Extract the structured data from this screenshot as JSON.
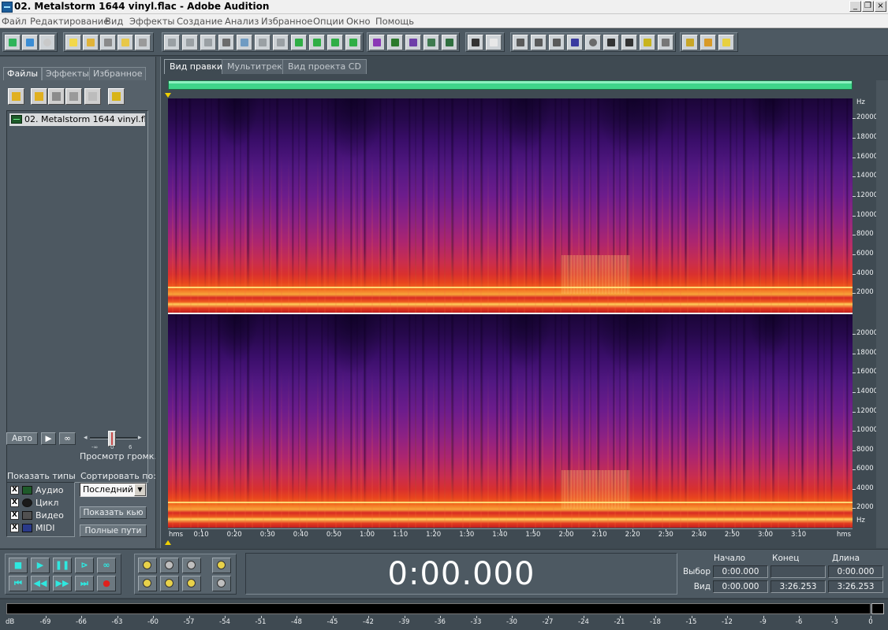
{
  "window": {
    "title": "02. Metalstorm 1644 vinyl.flac - Adobe Audition",
    "controls": [
      "_",
      "❐",
      "×"
    ]
  },
  "menu": [
    "Файл",
    "Редактирование",
    "Вид",
    "Эффекты",
    "Создание",
    "Анализ",
    "Избранное",
    "Опции",
    "Окно",
    "Помощь"
  ],
  "toolbar": {
    "tools": [
      "waveform-view-icon",
      "multitrack-view-icon",
      "cd-view-icon",
      "new-icon",
      "open-icon",
      "save-icon",
      "save-all-icon",
      "close-file-icon",
      "undo-icon",
      "redo-icon",
      "repeat-icon",
      "copy-icon",
      "paste-icon",
      "cut-icon",
      "trim-icon",
      "mix-paste-icon",
      "insert-icon",
      "extract-icon",
      "loop-icon",
      "spectral-view-icon",
      "waveform-icon",
      "spectral-pan-icon",
      "spectral-phase-icon",
      "spectral-freq-icon",
      "time-selection-icon",
      "marquee-icon",
      "window-1-icon",
      "window-2-icon",
      "window-3-icon",
      "play-marker-icon",
      "zoom-icon",
      "time-format-icon",
      "ruler-icon",
      "level-icon",
      "bar-icon",
      "settings-icon",
      "gear-icon",
      "help-icon"
    ],
    "accent": "#cdd2d6"
  },
  "left_panel": {
    "tabs": [
      "Файлы",
      "Эффекты",
      "Избранное"
    ],
    "active_tab": "Файлы",
    "file_actions": [
      "import-icon",
      "open-folder-icon",
      "properties-icon",
      "close-icon",
      "insert-icon",
      "sort-icon"
    ],
    "files": [
      "02. Metalstorm 1644 vinyl.flac"
    ],
    "auto_button": "Авто",
    "volume": {
      "label": "Просмотр громк.",
      "ticks": [
        "-∞",
        "0",
        "6"
      ],
      "level_db": 0
    },
    "show_types_label": "Показать типы",
    "types": [
      {
        "label": "Аудио",
        "checked": "X",
        "icon": "audio-type-icon"
      },
      {
        "label": "Цикл",
        "checked": "X",
        "icon": "loop-type-icon"
      },
      {
        "label": "Видео",
        "checked": "X",
        "icon": "video-type-icon"
      },
      {
        "label": "MIDI",
        "checked": "X",
        "icon": "midi-type-icon"
      }
    ],
    "sort_label": "Сортировать по:",
    "sort_value": "Последний д",
    "show_cues_button": "Показать кью",
    "full_paths_button": "Полные пути"
  },
  "view_tabs": [
    "Вид правки",
    "Мультитрек",
    "Вид проекта CD"
  ],
  "active_view": "Вид правки",
  "spectrogram": {
    "freq_unit": "Hz",
    "freq_labels": [
      "20000",
      "18000",
      "16000",
      "14000",
      "12000",
      "10000",
      "8000",
      "6000",
      "4000",
      "2000"
    ],
    "freq_values": [
      20000,
      18000,
      16000,
      14000,
      12000,
      10000,
      8000,
      6000,
      4000,
      2000
    ],
    "freq_max": 22050,
    "time_unit": "hms",
    "time_labels": [
      "0:10",
      "0:20",
      "0:30",
      "0:40",
      "0:50",
      "1:00",
      "1:10",
      "1:20",
      "1:30",
      "1:40",
      "1:50",
      "2:00",
      "2:10",
      "2:20",
      "2:30",
      "2:40",
      "2:50",
      "3:00",
      "3:10"
    ],
    "time_seconds": [
      10,
      20,
      30,
      40,
      50,
      60,
      70,
      80,
      90,
      100,
      110,
      120,
      130,
      140,
      150,
      160,
      170,
      180,
      190
    ],
    "duration_seconds": 206.253,
    "colors": {
      "overview": "#3fd48a",
      "cursor": "#f0d000"
    }
  },
  "transport": {
    "buttons": [
      {
        "name": "stop-button",
        "glyph": "■"
      },
      {
        "name": "play-button",
        "glyph": "▶"
      },
      {
        "name": "pause-button",
        "glyph": "❚❚"
      },
      {
        "name": "play-to-end-button",
        "glyph": "⊳"
      },
      {
        "name": "loop-play-button",
        "glyph": "∞"
      },
      {
        "name": "go-to-start-button",
        "glyph": "⏮"
      },
      {
        "name": "rewind-button",
        "glyph": "◀◀"
      },
      {
        "name": "fast-forward-button",
        "glyph": "▶▶"
      },
      {
        "name": "go-to-end-button",
        "glyph": "⏭"
      },
      {
        "name": "record-button",
        "glyph": "●"
      }
    ],
    "zoom_buttons": [
      "zoom-in-horizontal-icon",
      "zoom-out-horizontal-icon",
      "zoom-full-icon",
      "zoom-in-vertical-icon",
      "zoom-to-left-icon",
      "zoom-to-right-icon",
      "zoom-selection-icon",
      "zoom-out-vertical-icon"
    ],
    "time_display": "0:00.000"
  },
  "selection": {
    "headers": [
      "Начало",
      "Конец",
      "Длина"
    ],
    "rows": [
      {
        "label": "Выбор",
        "values": [
          "0:00.000",
          "",
          "0:00.000"
        ]
      },
      {
        "label": "Вид",
        "values": [
          "0:00.000",
          "3:26.253",
          "3:26.253"
        ]
      }
    ]
  },
  "level_meter": {
    "unit": "dB",
    "ticks": [
      "-69",
      "-66",
      "-63",
      "-60",
      "-57",
      "-54",
      "-51",
      "-48",
      "-45",
      "-42",
      "-39",
      "-36",
      "-33",
      "-30",
      "-27",
      "-24",
      "-21",
      "-18",
      "-15",
      "-12",
      "-9",
      "-6",
      "-3",
      "0"
    ],
    "tick_values": [
      -69,
      -66,
      -63,
      -60,
      -57,
      -54,
      -51,
      -48,
      -45,
      -42,
      -39,
      -36,
      -33,
      -30,
      -27,
      -24,
      -21,
      -18,
      -15,
      -12,
      -9,
      -6,
      -3,
      0
    ],
    "min": -72,
    "max": 0
  }
}
